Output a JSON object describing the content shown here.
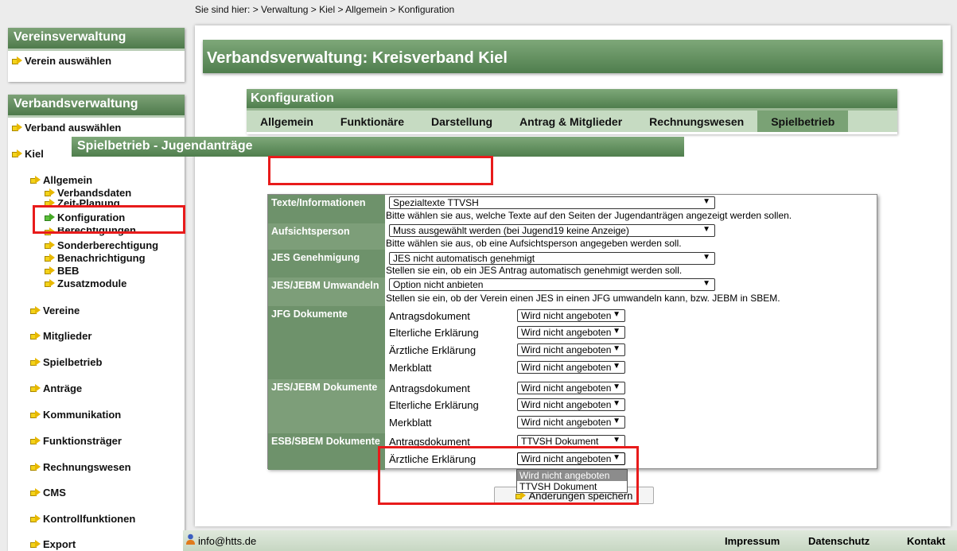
{
  "breadcrumb": "Sie sind hier: > Verwaltung > Kiel > Allgemein > Konfiguration",
  "nav": {
    "vereins_title": "Vereinsverwaltung",
    "verein_select": "Verein auswählen",
    "verbands_title": "Verbandsverwaltung",
    "verband_select": "Verband auswählen",
    "kiel": "Kiel",
    "allgemein": "Allgemein",
    "sub": [
      "Verbandsdaten",
      "Zeit-Planung",
      "Konfiguration",
      "Berechtigungen",
      "Sonderberechtigung",
      "Benachrichtigung",
      "BEB",
      "Zusatzmodule"
    ],
    "items": [
      "Vereine",
      "Mitglieder",
      "Spielbetrieb",
      "Anträge",
      "Kommunikation",
      "Funktionsträger",
      "Rechnungswesen",
      "CMS",
      "Kontrollfunktionen",
      "Export"
    ]
  },
  "page_title": "Verbandsverwaltung: Kreisverband Kiel",
  "config": {
    "title": "Konfiguration",
    "tabs": [
      "Allgemein",
      "Funktionäre",
      "Darstellung",
      "Antrag & Mitglieder",
      "Rechnungswesen",
      "Spielbetrieb"
    ],
    "active_tab": "Spielbetrieb"
  },
  "section_title": "Spielbetrieb - Jugendanträge",
  "rows": {
    "texte_label": "Texte/Informationen",
    "texte_value": "Spezialtexte TTVSH",
    "texte_hint": "Bitte wählen sie aus, welche Texte auf den Seiten der Jugendanträgen angezeigt werden sollen.",
    "aufsicht_label": "Aufsichtsperson",
    "aufsicht_value": "Muss ausgewählt werden (bei Jugend19 keine Anzeige)",
    "aufsicht_hint": "Bitte wählen sie aus, ob eine Aufsichtsperson angegeben werden soll.",
    "jes_label": "JES Genehmigung",
    "jes_value": "JES nicht automatisch genehmigt",
    "jes_hint": "Stellen sie ein, ob ein JES Antrag automatisch genehmigt werden soll.",
    "umwandeln_label": "JES/JEBM Umwandeln",
    "umwandeln_value": "Option nicht anbieten",
    "umwandeln_hint": "Stellen sie ein, ob der Verein einen JES in einen JFG umwandeln kann, bzw. JEBM in SBEM.",
    "jfg_label": "JFG Dokumente",
    "jesjebm_label": "JES/JEBM Dokumente",
    "esb_label": "ESB/SBEM Dokumente",
    "doc_antrag": "Antragsdokument",
    "doc_eltern": "Elterliche Erklärung",
    "doc_arzt": "Ärztliche Erklärung",
    "doc_merk": "Merkblatt",
    "opt_none": "Wird nicht angeboten",
    "opt_ttvsh": "TTVSH Dokument"
  },
  "dropdown_options": [
    "Wird nicht angeboten",
    "TTVSH Dokument"
  ],
  "save_label": "Änderungen speichern",
  "footer": {
    "email": "info@htts.de",
    "impressum": "Impressum",
    "datenschutz": "Datenschutz",
    "kontakt": "Kontakt"
  },
  "colors": {
    "header_green": "#5d8a5a",
    "tab_bg": "#c6dbc2",
    "highlight_red": "#e81b1b"
  }
}
